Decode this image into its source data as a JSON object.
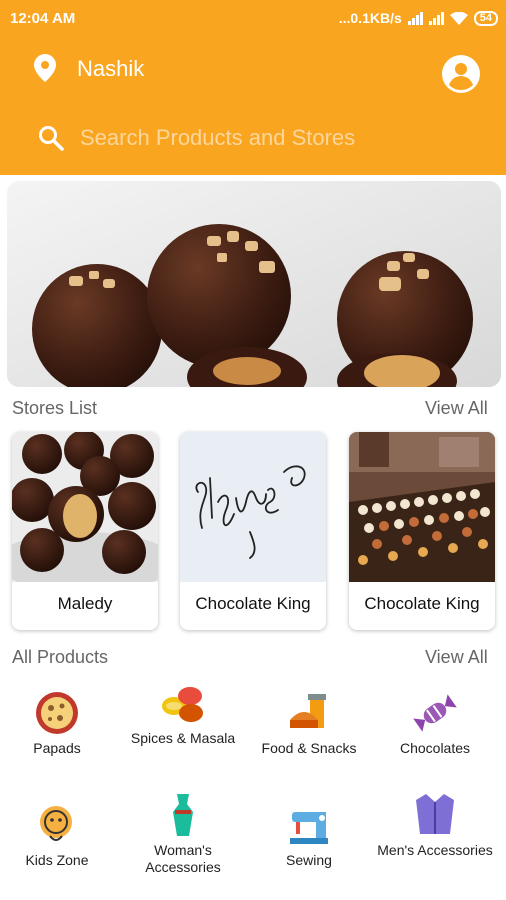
{
  "status_bar": {
    "time": "12:04 AM",
    "speed": "...0.1KB/s",
    "battery": "54"
  },
  "header": {
    "city": "Nashik"
  },
  "search": {
    "placeholder": "Search Products and Stores"
  },
  "stores_section": {
    "title": "Stores List",
    "view_all": "View All"
  },
  "stores": [
    {
      "name": "Maledy"
    },
    {
      "name": "Chocolate King"
    },
    {
      "name": "Chocolate King"
    }
  ],
  "products_section": {
    "title": "All Products",
    "view_all": "View All"
  },
  "categories": [
    {
      "label": "Papads",
      "icon": "papad-icon"
    },
    {
      "label": "Spices & Masala",
      "icon": "spices-icon"
    },
    {
      "label": "Food & Snacks",
      "icon": "food-snacks-icon"
    },
    {
      "label": "Chocolates",
      "icon": "candy-icon"
    },
    {
      "label": "Kids Zone",
      "icon": "kids-icon"
    },
    {
      "label": "Woman's Accessories",
      "icon": "dress-icon"
    },
    {
      "label": "Sewing",
      "icon": "sewing-machine-icon"
    },
    {
      "label": "Men's Accessories",
      "icon": "jacket-icon"
    }
  ],
  "colors": {
    "accent": "#f9a520"
  }
}
